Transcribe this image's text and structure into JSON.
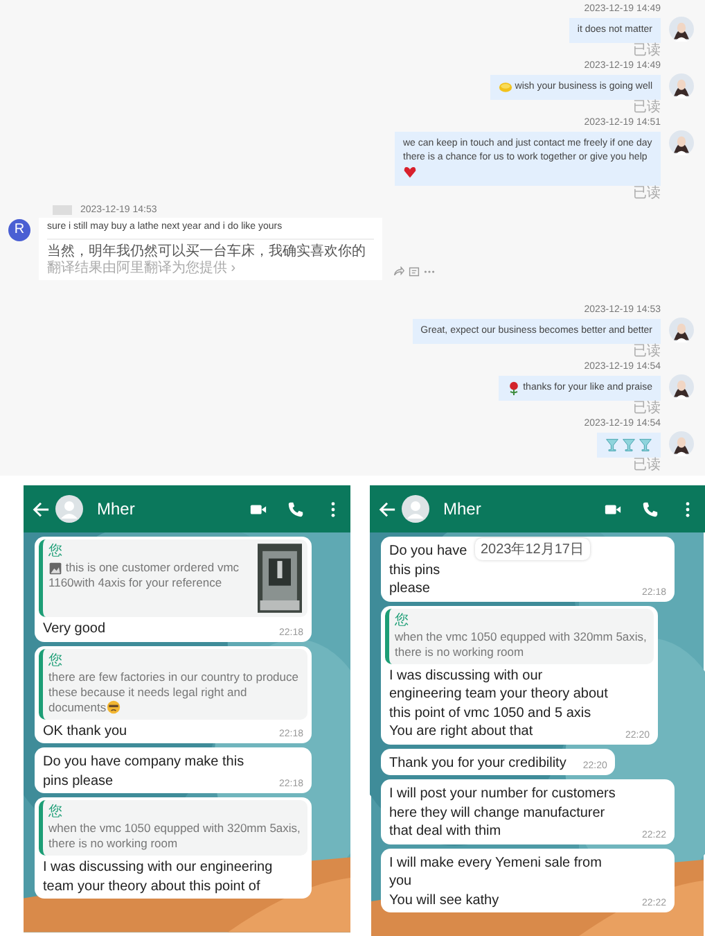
{
  "desktop_chat": {
    "messages": [
      {
        "kind": "sent",
        "time": "2023-12-19 14:49",
        "text": "it does not matter",
        "read": "已读"
      },
      {
        "kind": "emojilead",
        "time": "2023-12-19 14:49",
        "text": "wish your business is going well",
        "read": "已读"
      },
      {
        "kind": "emojitrail",
        "time": "2023-12-19 14:51",
        "text": "we can keep in touch and just contact me freely if one day there is a chance for us to work together or give you help",
        "read": "已读"
      },
      {
        "kind": "received",
        "avatar": "R",
        "time": "2023-12-19 14:53",
        "text": "sure i still may buy a lathe next year and i do like yours",
        "translation": "当然，明年我仍然可以买一台车床，我确实喜欢你的",
        "translate_note": "翻译结果由阿里翻译为您提供 ›"
      },
      {
        "kind": "sent",
        "time": "2023-12-19 14:53",
        "text": "Great, expect our business becomes better and better",
        "read": "已读"
      },
      {
        "kind": "emojilead",
        "time": "2023-12-19 14:54",
        "text": "thanks for your like and praise",
        "read": "已读"
      },
      {
        "kind": "stickers",
        "time": "2023-12-19 14:54",
        "read": "已读"
      }
    ]
  },
  "phone_chats": [
    {
      "contact": "Mher",
      "messages": [
        {
          "quote_author": "您",
          "quote": "this is one customer ordered vmc 1160with 4axis for your reference",
          "quote_image": true,
          "text": "Very good",
          "time": "22:18"
        },
        {
          "quote_author": "您",
          "quote": "there are few factories  in our country to produce these because it needs legal right and documents",
          "quote_emoji": true,
          "text": "OK thank you",
          "time": "22:18"
        },
        {
          "text": "Do you have company make this pins please",
          "time": "22:18"
        },
        {
          "quote_author": "您",
          "quote": "when the vmc 1050 equpped with 320mm 5axis, there is no working  room",
          "text": "I was discussing with our engineering team your theory about this point of"
        }
      ]
    },
    {
      "contact": "Mher",
      "date_overlay": "2023年12月17日",
      "messages": [
        {
          "text": "Do you have",
          "text_after": "this pins",
          "text_end": "please",
          "time": "22:18"
        },
        {
          "quote_author": "您",
          "quote": "when the vmc 1050 equpped with 320mm 5axis, there is no working  room",
          "text": "I was discussing with our engineering team your theory about this point of vmc 1050 and 5 axis\nYou are right about that",
          "time": "22:20"
        },
        {
          "text": "Thank you for your credibility",
          "time": "22:20"
        },
        {
          "text": "I will  post your number for customers  here they will change manufacturer that deal with thim",
          "time": "22:22"
        },
        {
          "text": "I will make every Yemeni sale from you\nYou will see kathy",
          "time": "22:22"
        }
      ]
    }
  ]
}
